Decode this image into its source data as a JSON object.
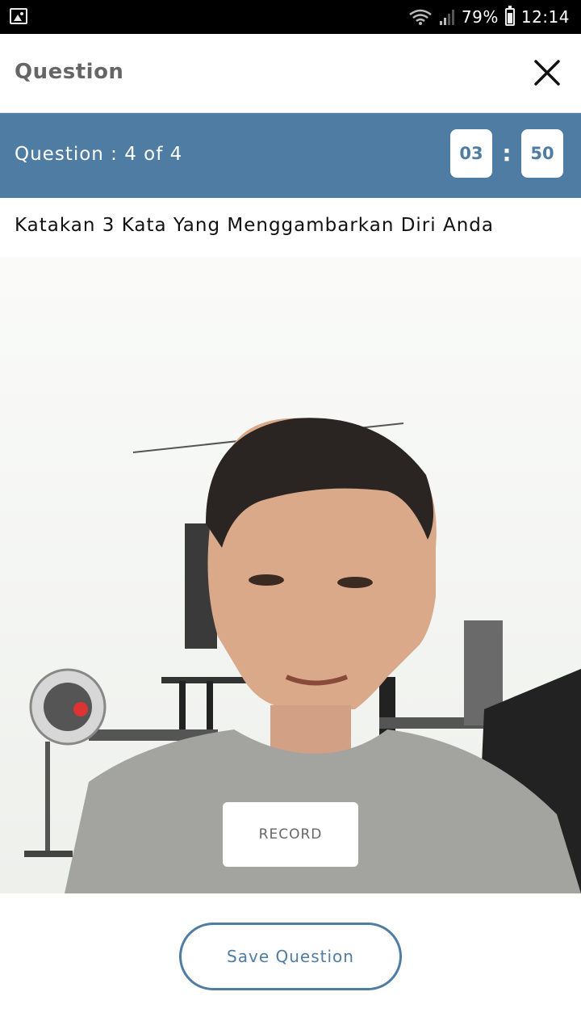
{
  "status_bar": {
    "battery": "79%",
    "time": "12:14",
    "icons": [
      "gallery-icon",
      "wifi-icon",
      "signal-icon",
      "battery-icon"
    ]
  },
  "header": {
    "title": "Question",
    "close_icon": "close-icon"
  },
  "question_bar": {
    "counter": "Question : 4 of 4",
    "timer_minutes": "03",
    "timer_separator": ":",
    "timer_seconds": "50"
  },
  "question": {
    "text": "Katakan 3 Kata Yang Menggambarkan Diri Anda"
  },
  "camera": {
    "record_label": "RECORD"
  },
  "actions": {
    "save_label": "Save Question"
  },
  "colors": {
    "primary": "#4e7ca3",
    "header_text": "#666666",
    "status_bar": "#000000"
  }
}
